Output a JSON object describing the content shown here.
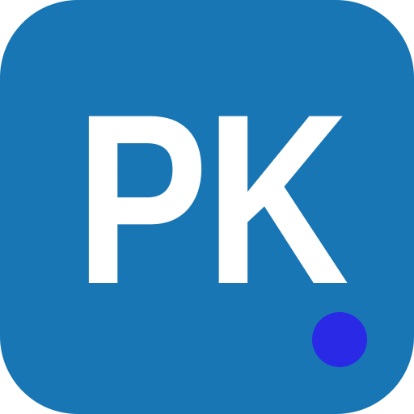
{
  "icon": {
    "monogram": "PK",
    "background_color": "#1876b5",
    "text_color": "#ffffff",
    "dot_color": "#2a29e6"
  }
}
